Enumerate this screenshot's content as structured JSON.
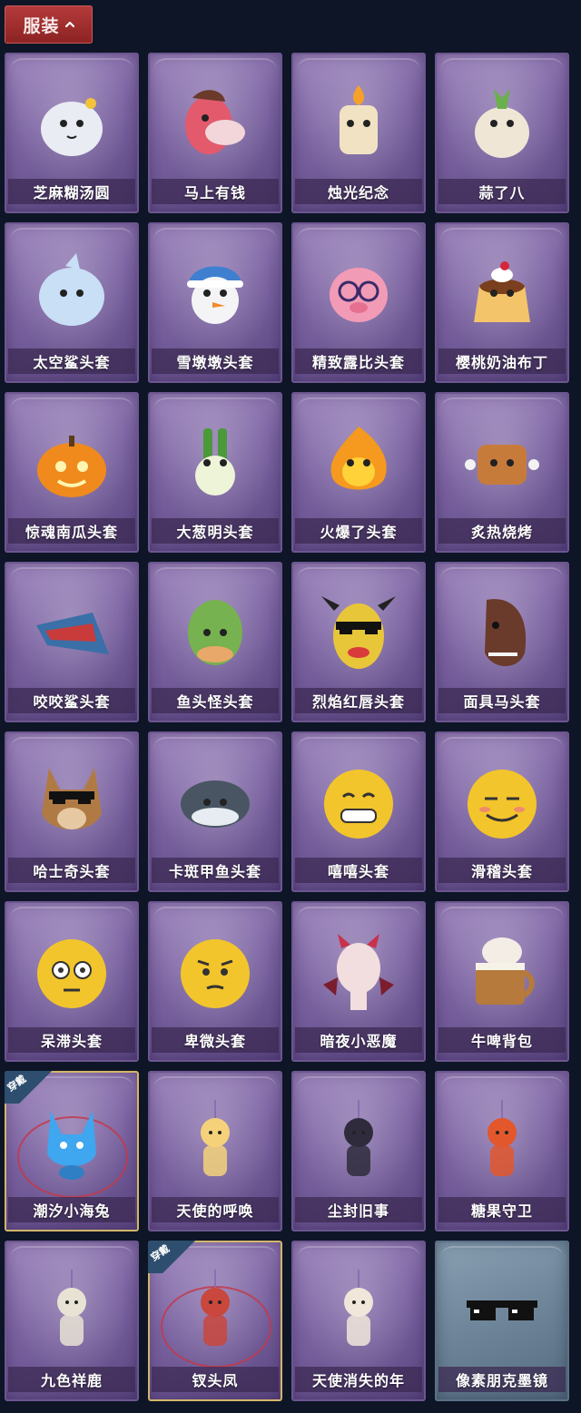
{
  "header": {
    "label": "服装",
    "toggle_icon": "chevron-up-icon"
  },
  "items": [
    {
      "name": "芝麻糊汤圆",
      "icon": "sesame-dumpling-icon",
      "color": "#e9ecf3",
      "skin": "purple"
    },
    {
      "name": "马上有钱",
      "icon": "pink-horse-icon",
      "color": "#e25a6c",
      "skin": "purple"
    },
    {
      "name": "烛光纪念",
      "icon": "candle-icon",
      "color": "#f2e2c4",
      "skin": "purple"
    },
    {
      "name": "蒜了八",
      "icon": "garlic-icon",
      "color": "#efe6d6",
      "skin": "purple"
    },
    {
      "name": "太空鲨头套",
      "icon": "space-shark-icon",
      "color": "#c8dff5",
      "skin": "purple"
    },
    {
      "name": "雪墩墩头套",
      "icon": "snowman-icon",
      "color": "#f4f4f7",
      "skin": "purple"
    },
    {
      "name": "精致露比头套",
      "icon": "pink-pig-glasses-icon",
      "color": "#f29bb6",
      "skin": "purple"
    },
    {
      "name": "樱桃奶油布丁",
      "icon": "pudding-icon",
      "color": "#f4c46a",
      "skin": "purple"
    },
    {
      "name": "惊魂南瓜头套",
      "icon": "pumpkin-icon",
      "color": "#f08a1c",
      "skin": "purple"
    },
    {
      "name": "大葱明头套",
      "icon": "scallion-icon",
      "color": "#8fd36a",
      "skin": "purple"
    },
    {
      "name": "火爆了头套",
      "icon": "fireball-icon",
      "color": "#f59a1e",
      "skin": "purple"
    },
    {
      "name": "炙热烧烤",
      "icon": "bbq-meat-icon",
      "color": "#c77b3b",
      "skin": "purple"
    },
    {
      "name": "咬咬鲨头套",
      "icon": "biting-shark-icon",
      "color": "#3a6fa8",
      "skin": "purple"
    },
    {
      "name": "鱼头怪头套",
      "icon": "fish-monster-icon",
      "color": "#76b24f",
      "skin": "purple"
    },
    {
      "name": "烈焰红唇头套",
      "icon": "yellow-mask-icon",
      "color": "#e8c63a",
      "skin": "purple"
    },
    {
      "name": "面具马头套",
      "icon": "horse-mask-icon",
      "color": "#6a3a2a",
      "skin": "purple"
    },
    {
      "name": "哈士奇头套",
      "icon": "dog-sunglasses-icon",
      "color": "#b07a45",
      "skin": "purple"
    },
    {
      "name": "卡斑甲鱼头套",
      "icon": "puffer-fish-icon",
      "color": "#4a5564",
      "skin": "purple"
    },
    {
      "name": "嘻嘻头套",
      "icon": "grin-emoji-icon",
      "color": "#f3c52c",
      "skin": "purple"
    },
    {
      "name": "滑稽头套",
      "icon": "sly-emoji-icon",
      "color": "#f3c52c",
      "skin": "purple"
    },
    {
      "name": "呆滞头套",
      "icon": "dazed-emoji-icon",
      "color": "#f3c52c",
      "skin": "purple"
    },
    {
      "name": "卑微头套",
      "icon": "humble-emoji-icon",
      "color": "#f3c52c",
      "skin": "purple"
    },
    {
      "name": "暗夜小恶魔",
      "icon": "devil-icon",
      "color": "#f2dede",
      "skin": "purple"
    },
    {
      "name": "牛啤背包",
      "icon": "beer-cow-icon",
      "color": "#b57a3c",
      "skin": "purple"
    },
    {
      "name": "潮汐小海兔",
      "icon": "sea-bunny-icon",
      "color": "#3fa6f0",
      "skin": "purple",
      "badge": "穿戴"
    },
    {
      "name": "天使的呼唤",
      "icon": "angel-charm-icon",
      "color": "#f5d27a",
      "skin": "purple"
    },
    {
      "name": "尘封旧事",
      "icon": "prince-charm-icon",
      "color": "#2f2b3c",
      "skin": "purple"
    },
    {
      "name": "糖果守卫",
      "icon": "candy-guard-icon",
      "color": "#e2572b",
      "skin": "purple"
    },
    {
      "name": "九色祥鹿",
      "icon": "deer-charm-icon",
      "color": "#e8e2d4",
      "skin": "purple"
    },
    {
      "name": "钗头凤",
      "icon": "phoenix-crown-icon",
      "color": "#c9473c",
      "skin": "purple",
      "badge": "穿戴"
    },
    {
      "name": "天使消失的年",
      "icon": "angel-girl-icon",
      "color": "#f1e6da",
      "skin": "purple"
    },
    {
      "name": "像素朋克墨镜",
      "icon": "pixel-sunglasses-icon",
      "color": "#111111",
      "skin": "steel"
    }
  ]
}
